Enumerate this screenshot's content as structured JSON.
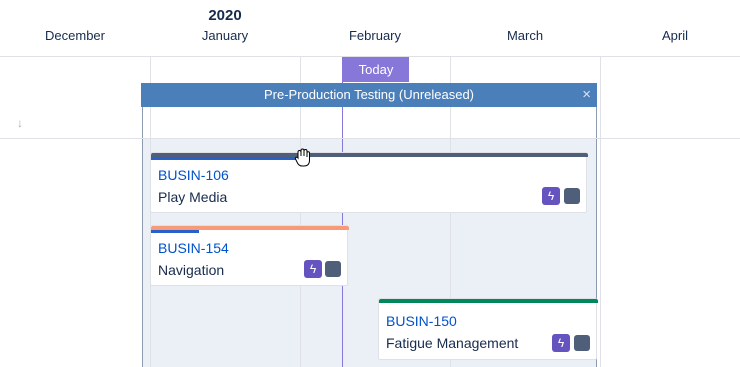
{
  "timeline": {
    "year": "2020",
    "months": [
      "December",
      "January",
      "February",
      "March",
      "April"
    ],
    "today_label": "Today"
  },
  "release": {
    "label": "Pre-Production Testing (Unreleased)",
    "close_glyph": "×"
  },
  "sort_icon_glyph": "↓",
  "colors": {
    "release_bar": "#4a7fba",
    "today": "#8777d9",
    "key_link": "#0052cc",
    "epic_icon": "#6554c0"
  },
  "cards": [
    {
      "key": "BUSIN-106",
      "title": "Play Media",
      "top_color": "#505f79",
      "progress_fraction": 0.36,
      "icons": [
        "lightning-icon",
        "square-icon"
      ]
    },
    {
      "key": "BUSIN-154",
      "title": "Navigation",
      "top_color": "#f79a78",
      "progress_fraction": 0.24,
      "icons": [
        "lightning-icon",
        "square-icon"
      ]
    },
    {
      "key": "BUSIN-150",
      "title": "Fatigue Management",
      "top_color": "#00875a",
      "progress_fraction": 0,
      "icons": [
        "lightning-icon",
        "square-icon"
      ]
    }
  ],
  "icon_glyphs": {
    "lightning": "ϟ"
  }
}
